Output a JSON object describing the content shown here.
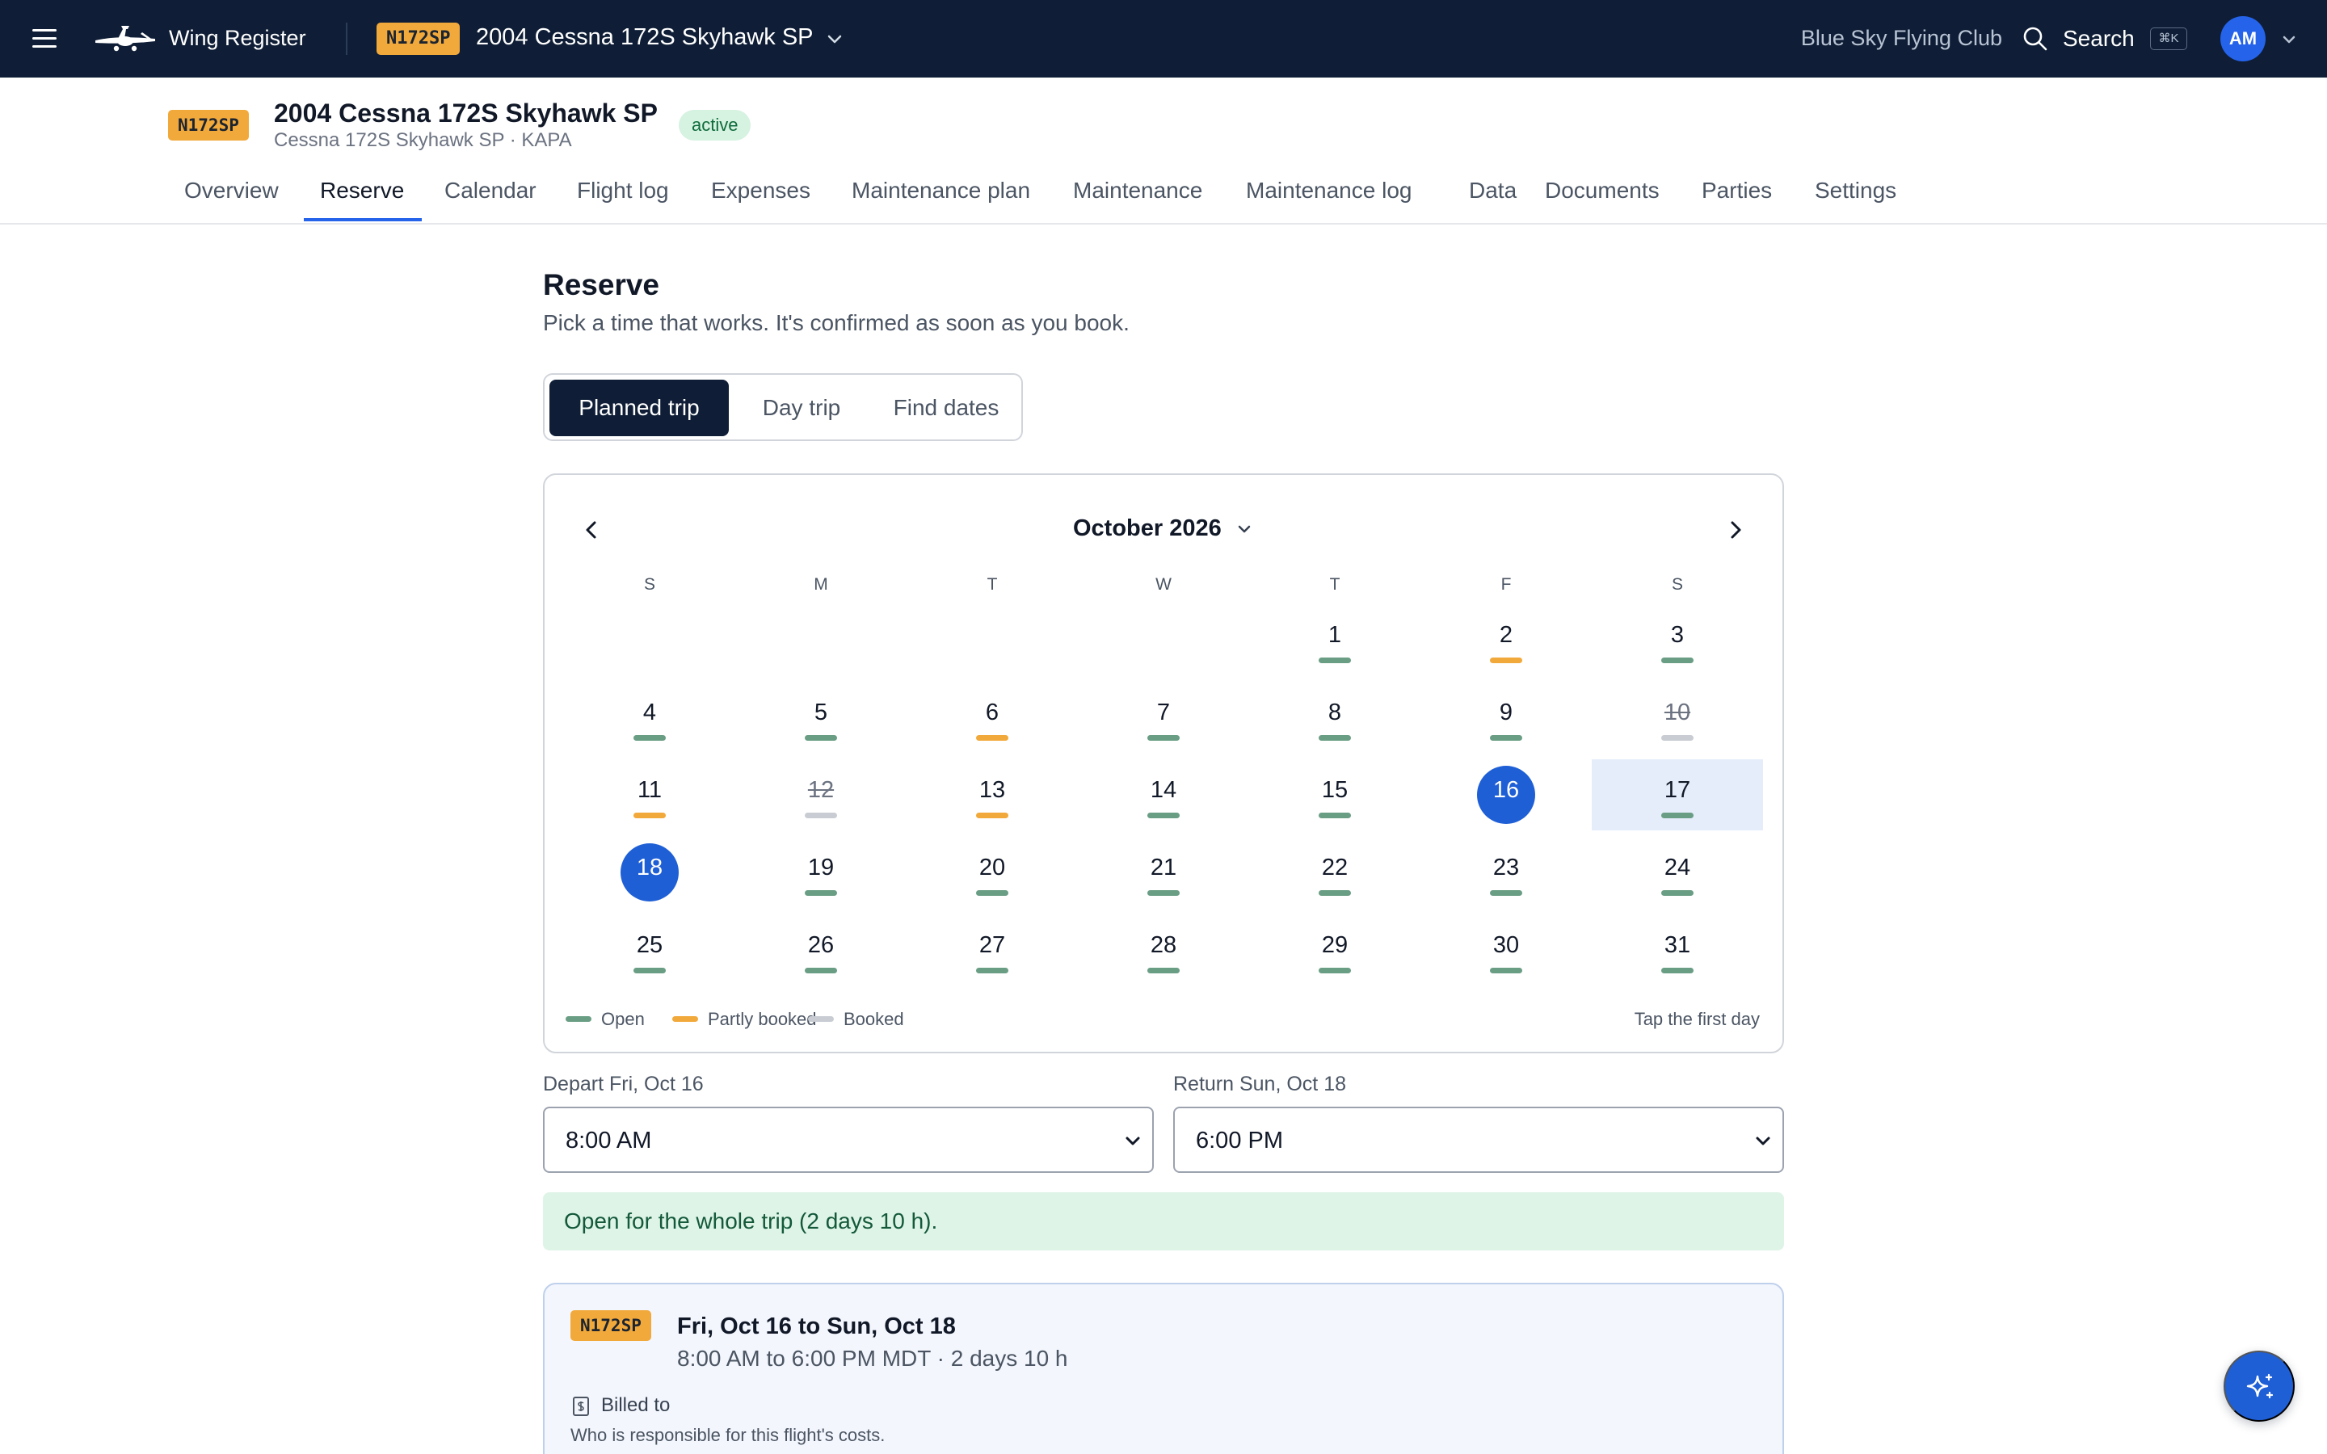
{
  "app": {
    "name": "Wing Register",
    "club": "Blue Sky Flying Club",
    "search_label": "Search",
    "search_shortcut": "⌘K",
    "user_initials": "AM"
  },
  "aircraft": {
    "tail": "N172SP",
    "title": "2004 Cessna 172S Skyhawk SP",
    "subtitle": "Cessna 172S Skyhawk SP · KAPA",
    "status": "active"
  },
  "tabs": [
    "Overview",
    "Reserve",
    "Calendar",
    "Flight log",
    "Expenses",
    "Maintenance plan",
    "Maintenance",
    "Maintenance log",
    "Data",
    "Documents",
    "Parties",
    "Settings"
  ],
  "active_tab": "Reserve",
  "reserve": {
    "title": "Reserve",
    "subtitle": "Pick a time that works. It's confirmed as soon as you book.",
    "modes": [
      "Planned trip",
      "Day trip",
      "Find dates"
    ],
    "active_mode": "Planned trip"
  },
  "calendar": {
    "month_label": "October 2026",
    "weekdays": [
      "S",
      "M",
      "T",
      "W",
      "T",
      "F",
      "S"
    ],
    "first_weekday_index": 4,
    "days": [
      {
        "d": "1",
        "s": "open"
      },
      {
        "d": "2",
        "s": "partly"
      },
      {
        "d": "3",
        "s": "open"
      },
      {
        "d": "4",
        "s": "open"
      },
      {
        "d": "5",
        "s": "open"
      },
      {
        "d": "6",
        "s": "partly"
      },
      {
        "d": "7",
        "s": "open"
      },
      {
        "d": "8",
        "s": "open"
      },
      {
        "d": "9",
        "s": "open"
      },
      {
        "d": "10",
        "s": "booked"
      },
      {
        "d": "11",
        "s": "partly"
      },
      {
        "d": "12",
        "s": "booked"
      },
      {
        "d": "13",
        "s": "partly"
      },
      {
        "d": "14",
        "s": "open"
      },
      {
        "d": "15",
        "s": "open"
      },
      {
        "d": "16",
        "s": "open",
        "selected": true
      },
      {
        "d": "17",
        "s": "open",
        "in_range": true
      },
      {
        "d": "18",
        "s": "open",
        "selected": true
      },
      {
        "d": "19",
        "s": "open"
      },
      {
        "d": "20",
        "s": "open"
      },
      {
        "d": "21",
        "s": "open"
      },
      {
        "d": "22",
        "s": "open"
      },
      {
        "d": "23",
        "s": "open"
      },
      {
        "d": "24",
        "s": "open"
      },
      {
        "d": "25",
        "s": "open"
      },
      {
        "d": "26",
        "s": "open"
      },
      {
        "d": "27",
        "s": "open"
      },
      {
        "d": "28",
        "s": "open"
      },
      {
        "d": "29",
        "s": "open"
      },
      {
        "d": "30",
        "s": "open"
      },
      {
        "d": "31",
        "s": "open"
      }
    ],
    "legend": [
      {
        "label": "Open",
        "status": "open"
      },
      {
        "label": "Partly booked",
        "status": "partly"
      },
      {
        "label": "Booked",
        "status": "booked"
      }
    ],
    "hint": "Tap the first day",
    "colors": {
      "open": "#6a9e84",
      "partly": "#f2a93b",
      "booked": "#c9cdd3",
      "selected": "#1f5fd6",
      "range": "#e5edfb"
    }
  },
  "trip": {
    "depart_label": "Depart Fri, Oct 16",
    "depart_time": "8:00 AM",
    "return_label": "Return Sun, Oct 18",
    "return_time": "6:00 PM",
    "availability": "Open for the whole trip (2 days 10 h)."
  },
  "summary": {
    "tail": "N172SP",
    "title": "Fri, Oct 16 to Sun, Oct 18",
    "detail": "8:00 AM to 6:00 PM MDT · 2 days 10 h",
    "billed_label": "Billed to",
    "billed_help": "Who is responsible for this flight's costs."
  }
}
